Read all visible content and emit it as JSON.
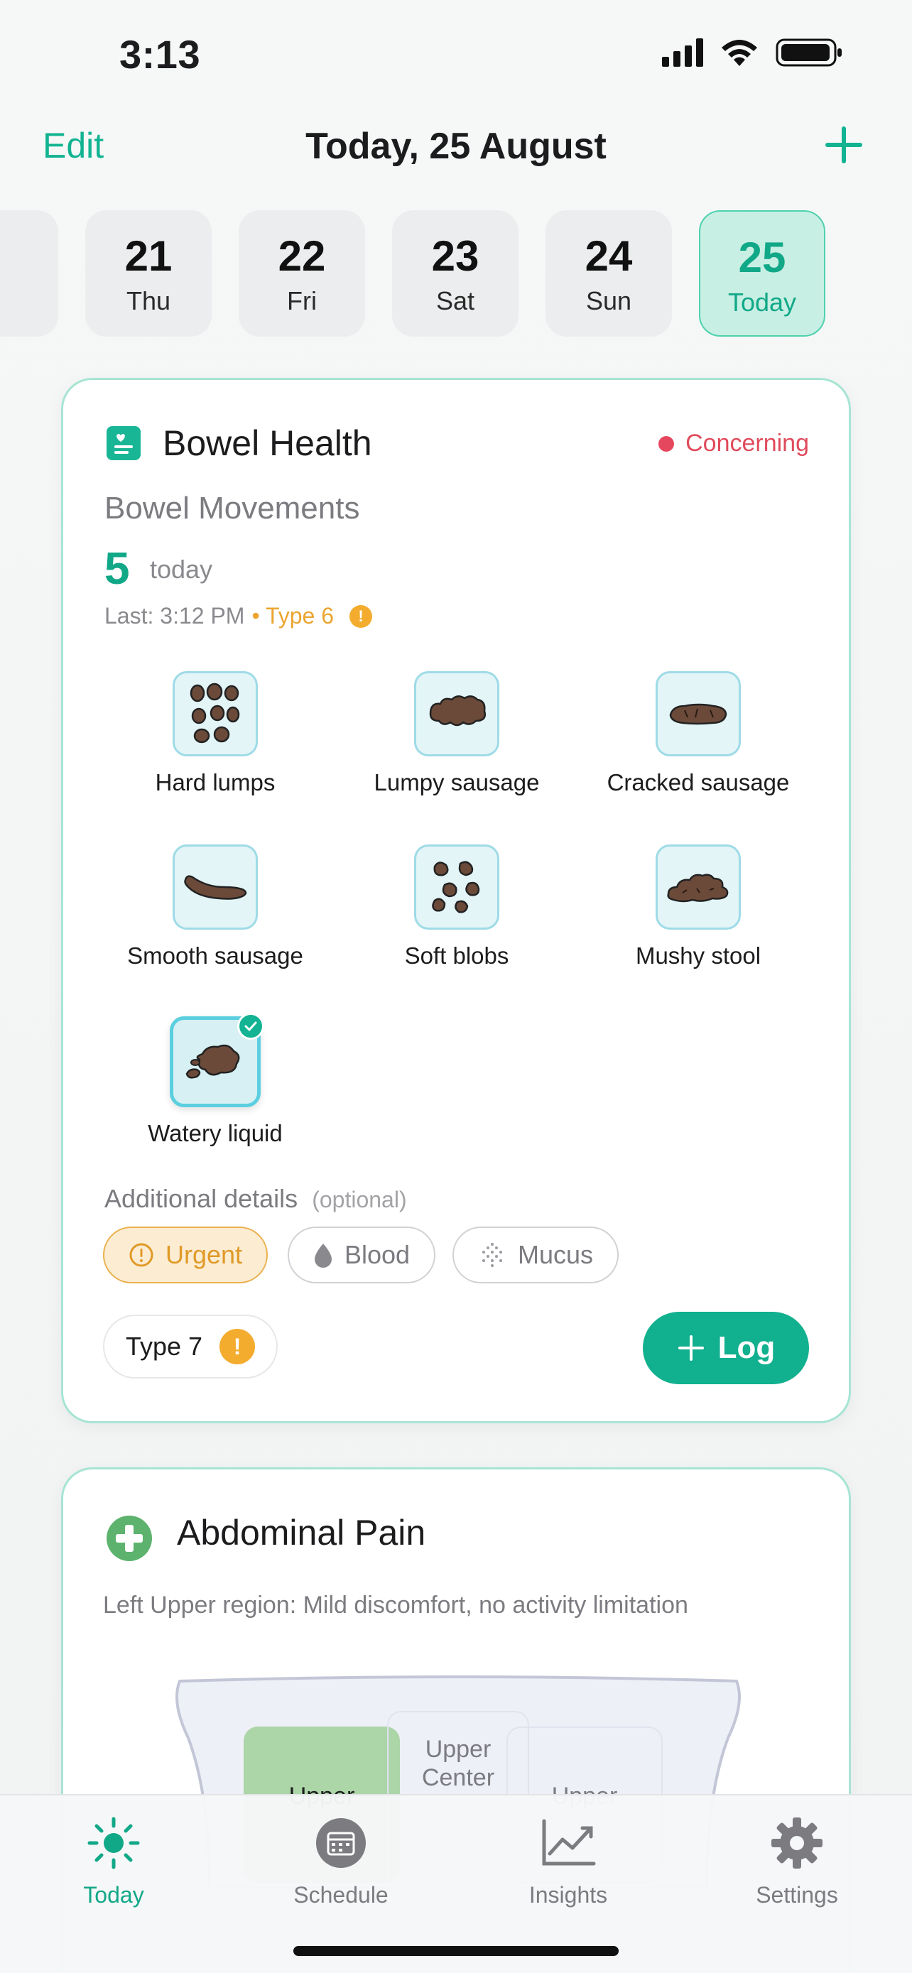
{
  "status_bar": {
    "time": "3:13"
  },
  "header": {
    "edit_label": "Edit",
    "title": "Today, 25 August"
  },
  "dates": [
    {
      "num": "21",
      "day": "Thu"
    },
    {
      "num": "22",
      "day": "Fri"
    },
    {
      "num": "23",
      "day": "Sat"
    },
    {
      "num": "24",
      "day": "Sun"
    },
    {
      "num": "25",
      "day": "Today"
    }
  ],
  "bowel": {
    "title": "Bowel Health",
    "status": "Concerning",
    "section_label": "Bowel Movements",
    "count": "5",
    "count_unit": "today",
    "last_prefix": "Last: 3:12 PM",
    "last_type": "• Type 6",
    "stool_types": [
      "Hard lumps",
      "Lumpy sausage",
      "Cracked sausage",
      "Smooth sausage",
      "Soft blobs",
      "Mushy stool",
      "Watery liquid"
    ],
    "selected_type": "Watery liquid",
    "details_label": "Additional details",
    "details_optional": "(optional)",
    "chips": {
      "urgent": "Urgent",
      "blood": "Blood",
      "mucus": "Mucus"
    },
    "type_pill": "Type 7",
    "log_label": "Log"
  },
  "pain": {
    "title": "Abdominal Pain",
    "description": "Left Upper region: Mild discomfort, no activity limitation",
    "regions": {
      "left": "Upper",
      "center_line1": "Upper",
      "center_line2": "Center",
      "right": "Upper"
    }
  },
  "tabs": {
    "today": "Today",
    "schedule": "Schedule",
    "insights": "Insights",
    "settings": "Settings"
  },
  "colors": {
    "accent": "#11b08e",
    "concerning": "#e5485e",
    "warning": "#f3ac2d"
  }
}
